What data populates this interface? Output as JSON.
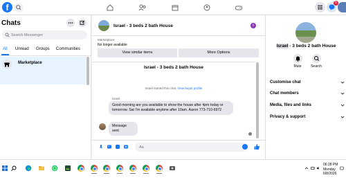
{
  "topnav": {
    "logo": "f",
    "notification_count": "5"
  },
  "left": {
    "title": "Chats",
    "search_placeholder": "Search Messenger",
    "filters": [
      "All",
      "Unread",
      "Groups",
      "Communities"
    ],
    "active_filter": "All",
    "conversation": {
      "name": "Marketplace"
    }
  },
  "chat": {
    "header_title": "Israel - 3 beds 2 bath House",
    "info_icon_label": "i",
    "listing": {
      "label": "Marketplace",
      "status": "No longer available",
      "view_similar": "View similar items",
      "more_options": "More Options"
    },
    "thread_title": "Israel - 3 beds 2 bath House",
    "system_message": "Israel started this chat.",
    "system_link": "View buyer profile",
    "sender": "Israel",
    "messages": [
      "Good morning are you available to show the house after 4pm today or tomorrow. Sat I'm available anytime after 10am. Aaron 773-710-6972",
      "Message sent"
    ],
    "composer_placeholder": "Aa"
  },
  "right": {
    "name_highlight": "Israel",
    "name_rest": " - 3 beds 2 bath House",
    "actions": [
      "Mute",
      "Search"
    ],
    "sections": [
      "Customise chat",
      "Chat members",
      "Media, files and links",
      "Privacy & support"
    ]
  },
  "taskbar": {
    "time": "06:28 PM",
    "day": "Monday",
    "date": "6/8/2026"
  },
  "colors": {
    "accent": "#1877f2",
    "badge": "#e41e3f",
    "bubble": "#e4e6eb"
  }
}
